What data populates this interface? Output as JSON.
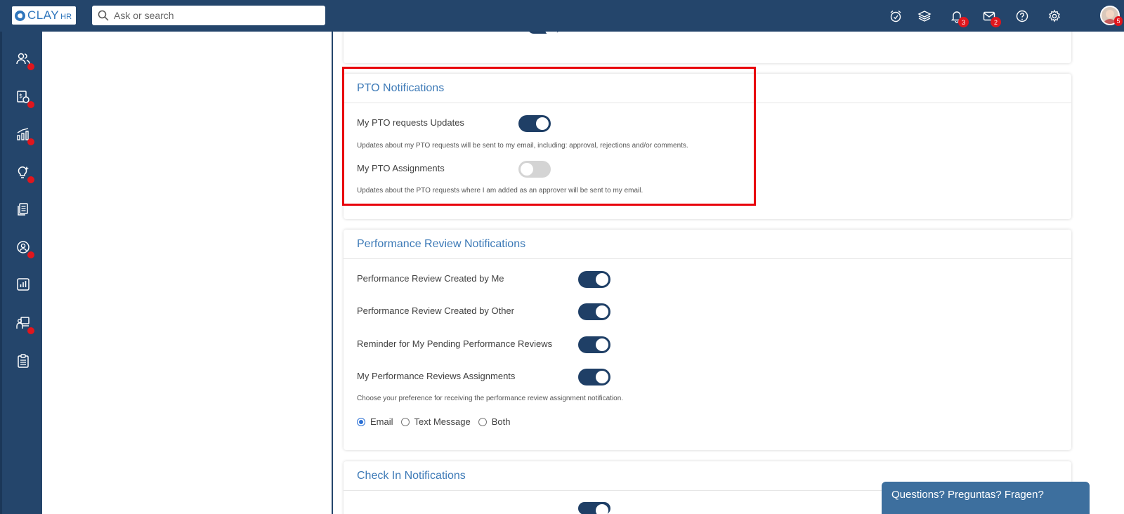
{
  "brand": {
    "logo_text": "CLAY",
    "logo_sub": "HR"
  },
  "search": {
    "placeholder": "Ask or search"
  },
  "topbar": {
    "icons": [
      "alarm-icon",
      "layers-icon",
      "bell-icon",
      "mail-icon",
      "help-icon",
      "gear-icon",
      "avatar"
    ],
    "notifications_count": "3",
    "messages_count": "2",
    "avatar_badge": "5"
  },
  "sidenav": {
    "items": [
      "people-icon",
      "payroll-icon",
      "growth-chart-icon",
      "lightbulb-icon",
      "documents-icon",
      "profile-icon",
      "reports-icon",
      "training-icon",
      "checklist-icon"
    ]
  },
  "pto": {
    "title": "PTO Notifications",
    "requests_label": "My PTO requests Updates",
    "requests_on": true,
    "requests_desc": "Updates about my PTO requests will be sent to my email, including: approval, rejections and/or comments.",
    "assignments_label": "My PTO Assignments",
    "assignments_on": false,
    "assignments_desc": "Updates about the PTO requests where I am added as an approver will be sent to my email."
  },
  "performance": {
    "title": "Performance Review Notifications",
    "items": [
      {
        "label": "Performance Review Created by Me",
        "on": true
      },
      {
        "label": "Performance Review Created by Other",
        "on": true
      },
      {
        "label": "Reminder for My Pending Performance Reviews",
        "on": true
      },
      {
        "label": "My Performance Reviews Assignments",
        "on": true
      }
    ],
    "preference_desc": "Choose your preference for receiving the performance review assignment notification.",
    "options": [
      "Email",
      "Text Message",
      "Both"
    ],
    "selected_option": "Email"
  },
  "checkin": {
    "title": "Check In Notifications"
  },
  "help": {
    "label": "Questions? Preguntas? Fragen?"
  },
  "colors": {
    "nav": "#24456b",
    "accent": "#3d7ab7",
    "toggle_on": "#1f3f66",
    "highlight": "#e8000b",
    "badge": "#e0161d"
  }
}
